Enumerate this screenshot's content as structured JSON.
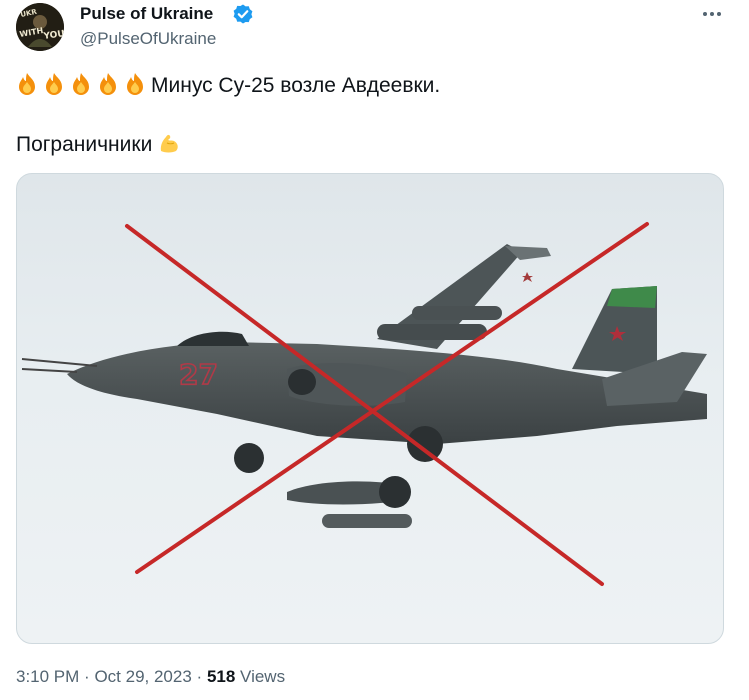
{
  "tweet": {
    "author": {
      "display_name": "Pulse of Ukraine",
      "handle": "@PulseOfUkraine",
      "verified": true,
      "avatar_icon": "avatar-image"
    },
    "more_icon": "more-icon",
    "text_line1": "Минус Су-25 возле Авдеевки.",
    "text_line1_emoji": [
      "fire-emoji",
      "fire-emoji",
      "fire-emoji",
      "fire-emoji",
      "fire-emoji"
    ],
    "text_line2": "Пограничники",
    "text_line2_emoji": "flexed-biceps-emoji",
    "media": {
      "description_icon": "crossed-out-aircraft-image",
      "tail_number": "27",
      "cross_color": "#c62828"
    },
    "time": "3:10 PM",
    "separator": "·",
    "date": "Oct 29, 2023",
    "views_count": "518",
    "views_label": "Views"
  },
  "colors": {
    "text": "#0f1419",
    "secondary": "#536471",
    "verified_blue": "#1d9bf0",
    "border": "#cfd9de"
  }
}
